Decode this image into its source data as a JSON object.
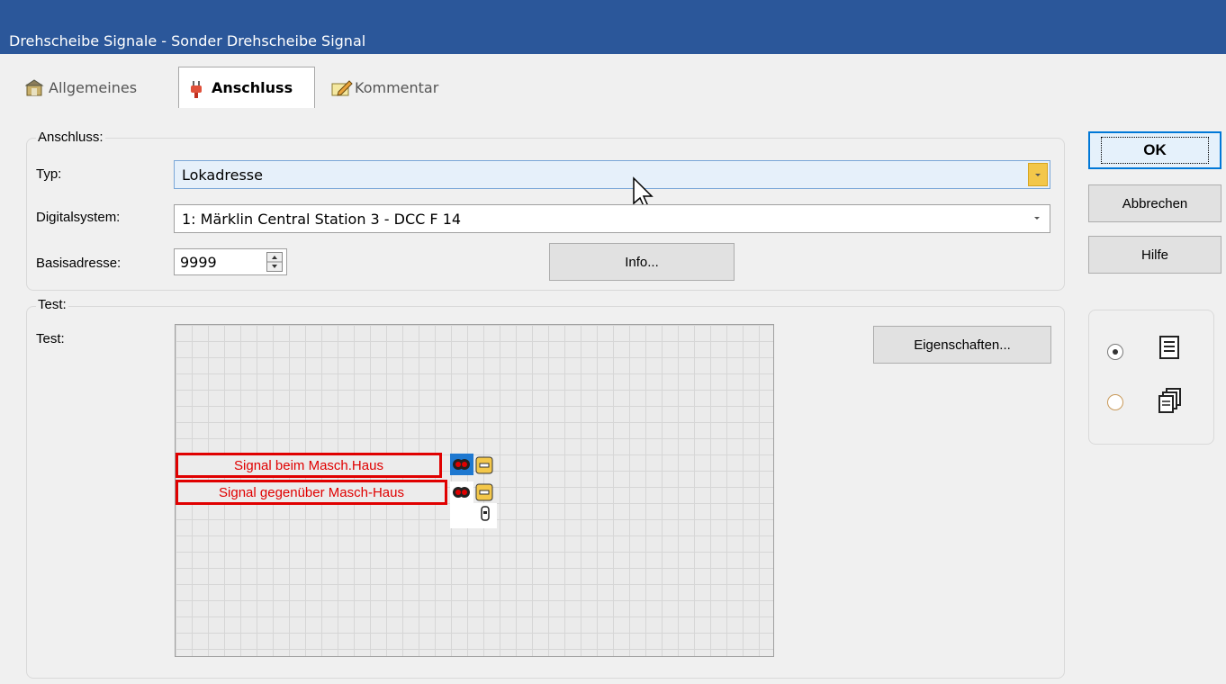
{
  "window": {
    "title": "Drehscheibe Signale - Sonder Drehscheibe Signal"
  },
  "tabs": [
    {
      "label": "Allgemeines",
      "icon": "properties-icon"
    },
    {
      "label": "Anschluss",
      "icon": "plug-icon"
    },
    {
      "label": "Kommentar",
      "icon": "note-pencil-icon"
    }
  ],
  "anschluss": {
    "group_label": "Anschluss:",
    "typ_label": "Typ:",
    "typ_value": "Lokadresse",
    "digital_label": "Digitalsystem:",
    "digital_value": "1: Märklin Central Station 3 - DCC F 14",
    "basis_label": "Basisadresse:",
    "basis_value": "9999",
    "info_button": "Info..."
  },
  "test": {
    "group_label": "Test:",
    "label": "Test:",
    "eigenschaften_button": "Eigenschaften...",
    "signals": [
      {
        "label": "Signal beim Masch.Haus"
      },
      {
        "label": "Signal gegenüber Masch-Haus"
      }
    ]
  },
  "buttons": {
    "ok": "OK",
    "abbrechen": "Abbrechen",
    "hilfe": "Hilfe"
  },
  "view_options": [
    {
      "icon": "list-view-icon",
      "checked": true
    },
    {
      "icon": "copies-view-icon",
      "checked": false
    }
  ],
  "colors": {
    "titlebar": "#2b579a",
    "accent_dropdown": "#f3c74a",
    "signal_border": "#e00000"
  }
}
